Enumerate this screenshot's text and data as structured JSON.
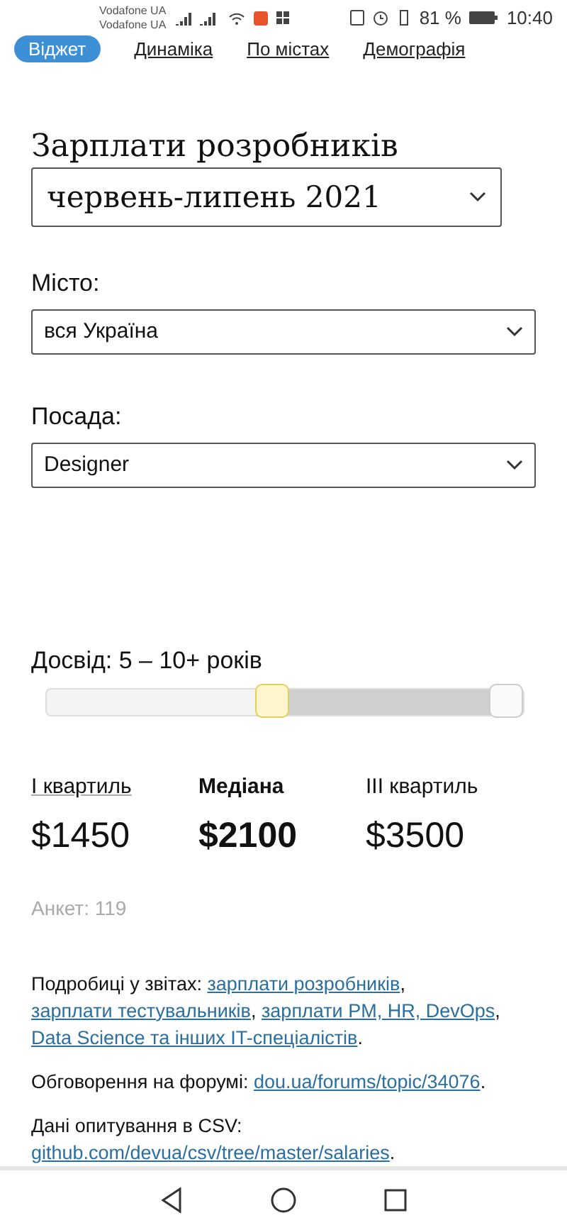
{
  "status_bar": {
    "carriers": [
      "Vodafone UA",
      "Vodafone UA"
    ],
    "battery": "81 %",
    "time": "10:40"
  },
  "tabs": [
    {
      "label": "Віджет",
      "selected": true
    },
    {
      "label": "Динаміка",
      "selected": false
    },
    {
      "label": "По містах",
      "selected": false
    },
    {
      "label": "Демографія",
      "selected": false
    }
  ],
  "title": "Зарплати розробників",
  "period": {
    "value": "червень-липень 2021"
  },
  "filters": [
    {
      "label": "Місто:",
      "value": "вся Україна"
    },
    {
      "label": "Посада:",
      "value": "Designer"
    }
  ],
  "experience": {
    "label": "Досвід: 5 – 10+ років",
    "thumbs": [
      {
        "level": 0.47
      },
      {
        "level": 1
      }
    ]
  },
  "stats": [
    {
      "label": "I квартиль",
      "value": "$1450",
      "emphasis": false,
      "underlined": true
    },
    {
      "label": "Медіана",
      "value": "$2100",
      "emphasis": true,
      "underlined": false
    },
    {
      "label": "III квартиль",
      "value": "$3500",
      "emphasis": false,
      "underlined": false
    }
  ],
  "responses": "Анкет: 119",
  "notes": [
    {
      "parts": [
        {
          "kind": "text",
          "text": "Подробиці у звітах: "
        },
        {
          "kind": "link",
          "text": "зарплати розробників"
        },
        {
          "kind": "text",
          "text": ", "
        },
        {
          "kind": "link",
          "text": "зарплати тестувальників"
        },
        {
          "kind": "text",
          "text": ", "
        },
        {
          "kind": "link",
          "text": "зарплати PM, HR, DevOps"
        },
        {
          "kind": "text",
          "text": ", "
        },
        {
          "kind": "link",
          "text": "Data Science та інших IT-спеціалістів"
        },
        {
          "kind": "text",
          "text": "."
        }
      ]
    },
    {
      "parts": [
        {
          "kind": "text",
          "text": "Обговорення на форумі: "
        },
        {
          "kind": "link",
          "text": "dou.ua/forums/topic/34076"
        },
        {
          "kind": "text",
          "text": "."
        }
      ]
    },
    {
      "parts": [
        {
          "kind": "text",
          "text": "Дані опитування в CSV: "
        },
        {
          "kind": "link",
          "text": "github.com/devua/csv/tree/master/salaries"
        },
        {
          "kind": "text",
          "text": "."
        }
      ]
    }
  ]
}
